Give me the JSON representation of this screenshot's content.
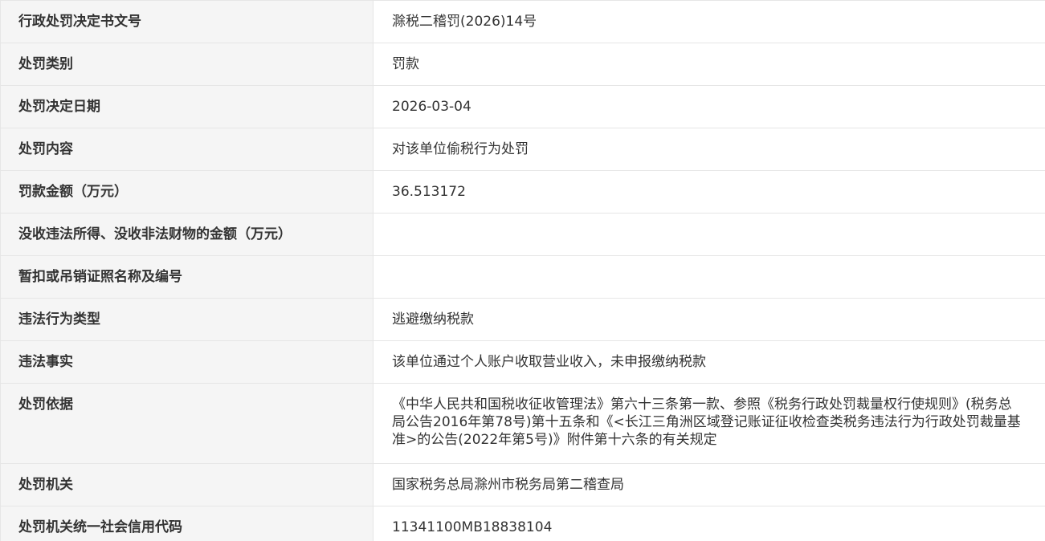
{
  "rows": [
    {
      "label": "行政处罚决定书文号",
      "value": "滁税二稽罚(2026)14号"
    },
    {
      "label": "处罚类别",
      "value": "罚款"
    },
    {
      "label": "处罚决定日期",
      "value": "2026-03-04"
    },
    {
      "label": "处罚内容",
      "value": "对该单位偷税行为处罚"
    },
    {
      "label": "罚款金额（万元）",
      "value": "36.513172"
    },
    {
      "label": "没收违法所得、没收非法财物的金额（万元）",
      "value": ""
    },
    {
      "label": "暂扣或吊销证照名称及编号",
      "value": ""
    },
    {
      "label": "违法行为类型",
      "value": "逃避缴纳税款"
    },
    {
      "label": "违法事实",
      "value": "该单位通过个人账户收取营业收入，未申报缴纳税款"
    },
    {
      "label": "处罚依据",
      "value": "《中华人民共和国税收征收管理法》第六十三条第一款、参照《税务行政处罚裁量权行使规则》(税务总局公告2016年第78号)第十五条和《<长江三角洲区域登记账证征收检查类税务违法行为行政处罚裁量基准>的公告(2022年第5号)》附件第十六条的有关规定"
    },
    {
      "label": "处罚机关",
      "value": "国家税务总局滁州市税务局第二稽查局"
    },
    {
      "label": "处罚机关统一社会信用代码",
      "value": "11341100MB18838104"
    }
  ]
}
